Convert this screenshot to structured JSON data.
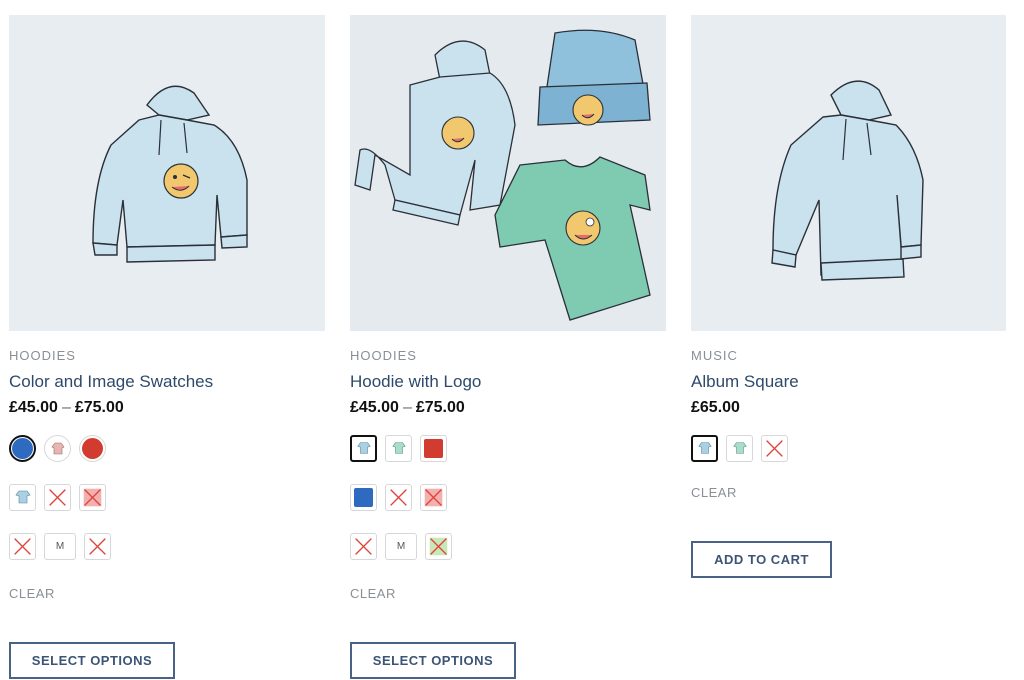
{
  "products": [
    {
      "category": "HOODIES",
      "title": "Color and Image Swatches",
      "price_from": "£45.00",
      "price_sep": "–",
      "price_to": "£75.00",
      "swatch_colors": {
        "blue": "#2d6ac0",
        "red": "#d23b30",
        "cross": "#e0413a"
      },
      "size_label": "M",
      "clear_label": "CLEAR",
      "button_label": "SELECT OPTIONS"
    },
    {
      "category": "HOODIES",
      "title": "Hoodie with Logo",
      "price_from": "£45.00",
      "price_sep": "–",
      "price_to": "£75.00",
      "swatch_colors": {
        "blue": "#2d6ac0",
        "red": "#d23b30",
        "cross": "#e0413a"
      },
      "size_label": "M",
      "clear_label": "CLEAR",
      "button_label": "SELECT OPTIONS"
    },
    {
      "category": "MUSIC",
      "title": "Album Square",
      "price": "£65.00",
      "clear_label": "CLEAR",
      "button_label": "ADD TO CART"
    }
  ],
  "colors": {
    "title": "#2d4a6b",
    "button_border": "#4a6283",
    "thumb_bg": "#e8edf1"
  }
}
